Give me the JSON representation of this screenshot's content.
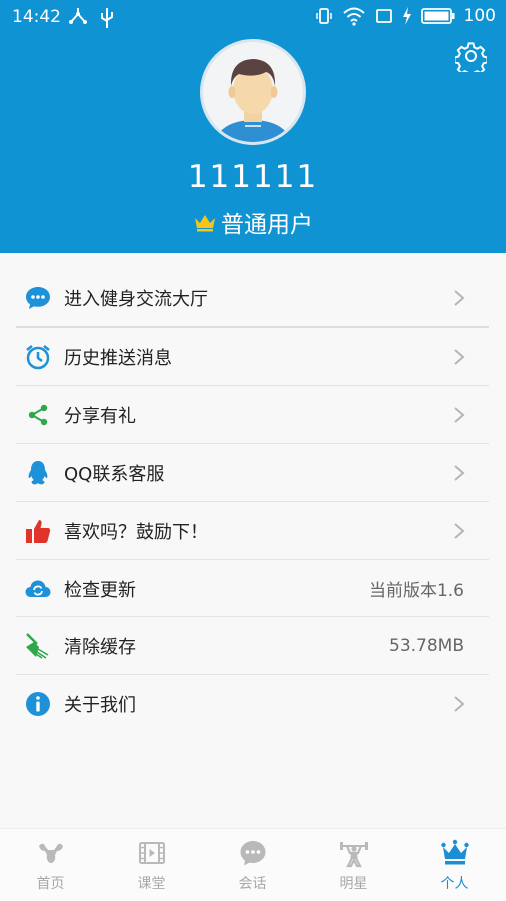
{
  "status_bar": {
    "time": "14:42",
    "battery": "100"
  },
  "profile": {
    "username": "111111",
    "user_type": "普通用户"
  },
  "menu": {
    "items": [
      {
        "label": "进入健身交流大厅",
        "icon": "chat-bubble-icon"
      },
      {
        "label": "历史推送消息",
        "icon": "alarm-clock-icon"
      },
      {
        "label": "分享有礼",
        "icon": "share-icon"
      },
      {
        "label": "QQ联系客服",
        "icon": "qq-penguin-icon"
      },
      {
        "label": "喜欢吗？鼓励下！",
        "icon": "thumbs-up-icon"
      },
      {
        "label": "检查更新",
        "icon": "cloud-refresh-icon",
        "value": "当前版本1.6"
      },
      {
        "label": "清除缓存",
        "icon": "broom-icon",
        "value": "53.78MB"
      },
      {
        "label": "关于我们",
        "icon": "info-icon"
      }
    ]
  },
  "tabs": [
    {
      "label": "首页",
      "icon": "muscle-home-icon"
    },
    {
      "label": "课堂",
      "icon": "film-icon"
    },
    {
      "label": "会话",
      "icon": "chat-icon"
    },
    {
      "label": "明星",
      "icon": "weightlifter-icon"
    },
    {
      "label": "个人",
      "icon": "crown-icon",
      "active": true
    }
  ],
  "colors": {
    "header": "#0f93d2",
    "active_tab": "#1a8fd6",
    "crown": "#f5c518"
  }
}
